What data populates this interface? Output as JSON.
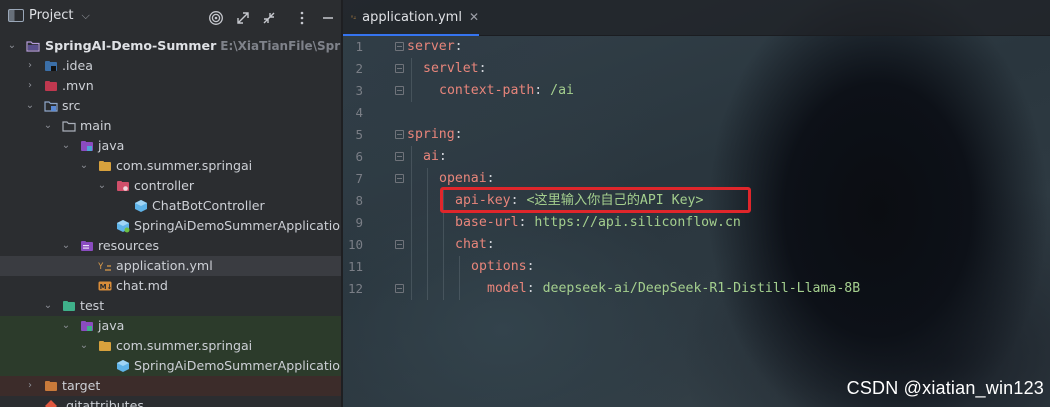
{
  "project_panel": {
    "title": "Project",
    "tree": [
      {
        "label": "SpringAI-Demo-Summer",
        "path": "E:\\XiaTianFile\\SpringAI\\S"
      },
      {
        "label": ".idea"
      },
      {
        "label": ".mvn"
      },
      {
        "label": "src"
      },
      {
        "label": "main"
      },
      {
        "label": "java"
      },
      {
        "label": "com.summer.springai"
      },
      {
        "label": "controller"
      },
      {
        "label": "ChatBotController"
      },
      {
        "label": "SpringAiDemoSummerApplication"
      },
      {
        "label": "resources"
      },
      {
        "label": "application.yml"
      },
      {
        "label": "chat.md"
      },
      {
        "label": "test"
      },
      {
        "label": "java"
      },
      {
        "label": "com.summer.springai"
      },
      {
        "label": "SpringAiDemoSummerApplicationTe"
      },
      {
        "label": "target"
      },
      {
        "label": ".gitattributes"
      }
    ]
  },
  "editor": {
    "tab_label": "application.yml",
    "line_numbers": [
      "1",
      "2",
      "3",
      "4",
      "5",
      "6",
      "7",
      "8",
      "9",
      "10",
      "11",
      "12"
    ],
    "lines": [
      {
        "key": "server",
        "sep": ":",
        "value": ""
      },
      {
        "key": "servlet",
        "sep": ":",
        "value": ""
      },
      {
        "key": "context-path",
        "sep": ": ",
        "value": "/ai"
      },
      {
        "key": "",
        "sep": "",
        "value": ""
      },
      {
        "key": "spring",
        "sep": ":",
        "value": ""
      },
      {
        "key": "ai",
        "sep": ":",
        "value": ""
      },
      {
        "key": "openai",
        "sep": ":",
        "value": ""
      },
      {
        "key": "api-key",
        "sep": ": ",
        "value": "<这里输入你自己的API Key>"
      },
      {
        "key": "base-url",
        "sep": ": ",
        "value": "https://api.siliconflow.cn"
      },
      {
        "key": "chat",
        "sep": ":",
        "value": ""
      },
      {
        "key": "options",
        "sep": ":",
        "value": ""
      },
      {
        "key": "model",
        "sep": ": ",
        "value": "deepseek-ai/DeepSeek-R1-Distill-Llama-8B"
      }
    ]
  },
  "watermark": "CSDN @xiatian_win123",
  "colors": {
    "highlight": "#e0262b",
    "accent": "#3574f0"
  }
}
